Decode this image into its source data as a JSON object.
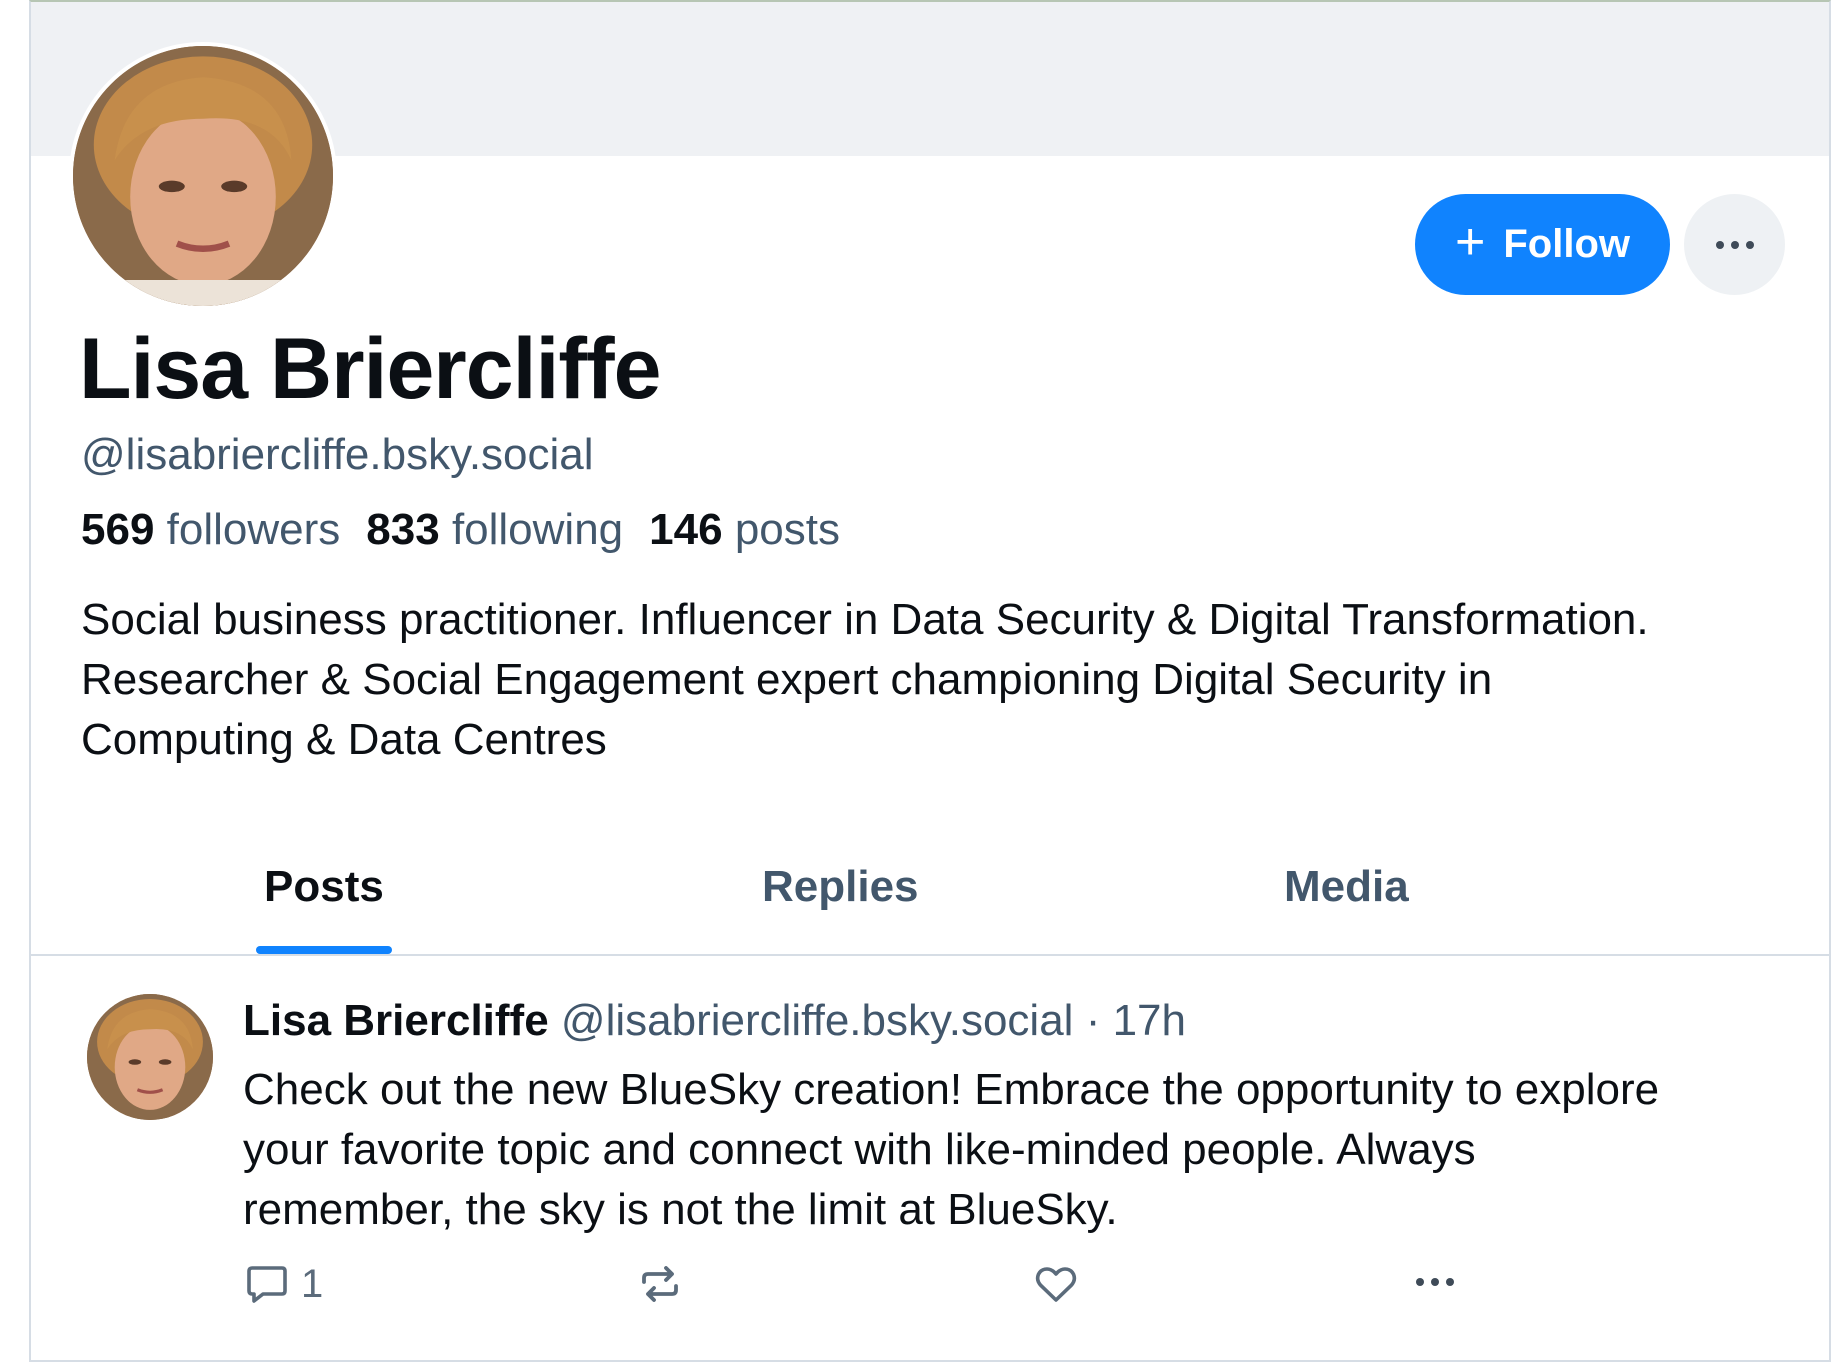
{
  "profile": {
    "display_name": "Lisa Briercliffe",
    "handle": "@lisabriercliffe.bsky.social",
    "followers_count": "569",
    "followers_label": "followers",
    "following_count": "833",
    "following_label": "following",
    "posts_count": "146",
    "posts_label": "posts",
    "bio_lines": [
      "Social business practitioner. Influencer in Data Security & Digital Transformation.",
      "Researcher & Social Engagement expert championing Digital Security in",
      "Computing & Data Centres"
    ],
    "avatar_icon": "profile-photo"
  },
  "actions": {
    "follow_icon": "plus-icon",
    "follow_label": "Follow",
    "more_icon": "ellipsis-icon"
  },
  "tabs": [
    {
      "label": "Posts",
      "active": true
    },
    {
      "label": "Replies",
      "active": false
    },
    {
      "label": "Media",
      "active": false
    }
  ],
  "feed": [
    {
      "author_name": "Lisa Briercliffe",
      "author_handle": "@lisabriercliffe.bsky.social",
      "separator": "·",
      "time": "17h",
      "text_lines": [
        "Check out the new BlueSky creation! Embrace the opportunity to explore",
        "your favorite topic and connect with like-minded people. Always",
        "remember, the sky is not the limit at BlueSky."
      ],
      "reply_count": "1",
      "icons": [
        "reply-icon",
        "repost-icon",
        "like-icon",
        "ellipsis-icon"
      ]
    }
  ],
  "colors": {
    "accent": "#1083fe",
    "text_primary": "#0b0f14",
    "text_secondary": "#42576c",
    "banner": "#eff1f4",
    "divider": "#d6dde5"
  }
}
